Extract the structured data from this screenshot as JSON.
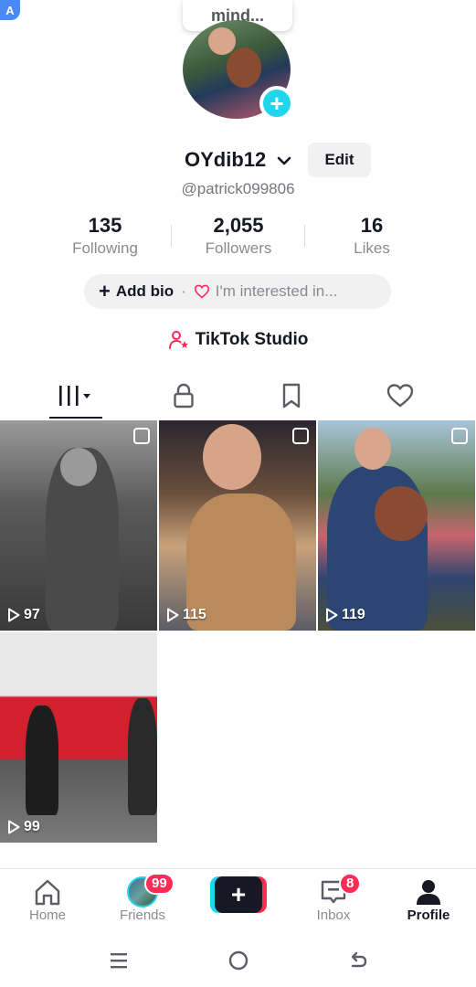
{
  "corner_badge": "A",
  "tooltip": "mind...",
  "profile": {
    "username": "OYdib12",
    "edit_label": "Edit",
    "handle": "@patrick099806"
  },
  "stats": [
    {
      "value": "135",
      "label": "Following"
    },
    {
      "value": "2,055",
      "label": "Followers"
    },
    {
      "value": "16",
      "label": "Likes"
    }
  ],
  "bio": {
    "add_label": "Add bio",
    "separator": "·",
    "interest_label": "I'm interested in..."
  },
  "studio_label": "TikTok Studio",
  "tabs": [
    {
      "icon": "videos-grid-icon"
    },
    {
      "icon": "lock-icon"
    },
    {
      "icon": "bookmark-icon"
    },
    {
      "icon": "heart-icon"
    }
  ],
  "videos": [
    {
      "views": "97"
    },
    {
      "views": "115"
    },
    {
      "views": "119"
    },
    {
      "views": "99"
    }
  ],
  "nav": {
    "home": "Home",
    "friends": "Friends",
    "friends_badge": "99",
    "create_symbol": "+",
    "inbox": "Inbox",
    "inbox_badge": "8",
    "profile": "Profile"
  },
  "colors": {
    "accent_cyan": "#20d5ec",
    "accent_red": "#fe2c55",
    "text_primary": "#161823",
    "text_secondary": "#8a8b91"
  }
}
